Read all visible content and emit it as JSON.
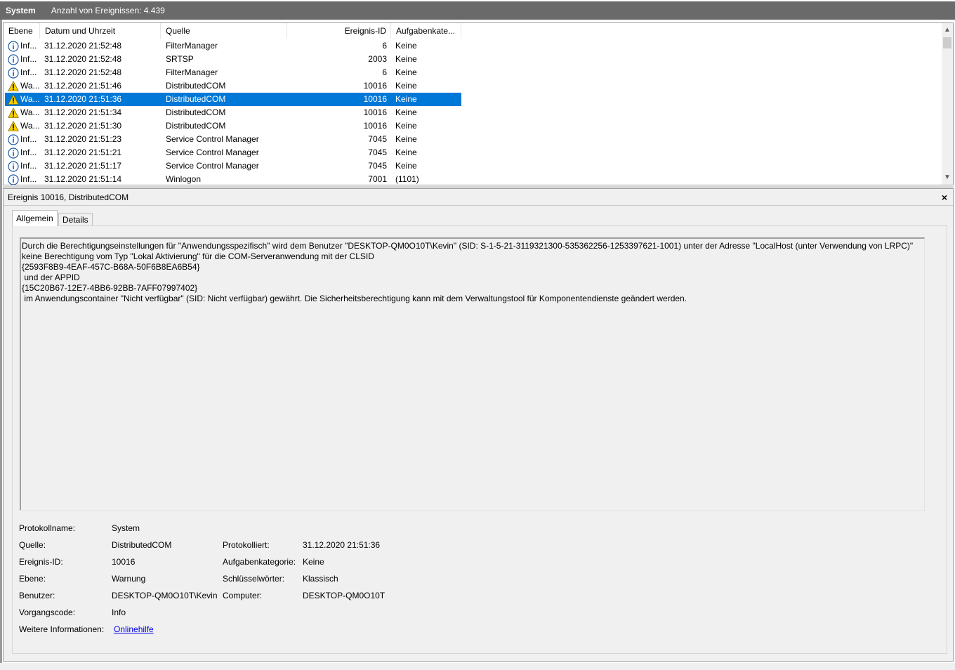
{
  "title": {
    "log": "System",
    "count_label": "Anzahl von Ereignissen: 4.439"
  },
  "columns": {
    "level": "Ebene",
    "date": "Datum und Uhrzeit",
    "source": "Quelle",
    "id": "Ereignis-ID",
    "task": "Aufgabenkate..."
  },
  "events": [
    {
      "type": "info",
      "level": "Inf...",
      "date": "31.12.2020 21:52:48",
      "source": "FilterManager",
      "id": "6",
      "task": "Keine"
    },
    {
      "type": "info",
      "level": "Inf...",
      "date": "31.12.2020 21:52:48",
      "source": "SRTSP",
      "id": "2003",
      "task": "Keine"
    },
    {
      "type": "info",
      "level": "Inf...",
      "date": "31.12.2020 21:52:48",
      "source": "FilterManager",
      "id": "6",
      "task": "Keine"
    },
    {
      "type": "warning",
      "level": "Wa...",
      "date": "31.12.2020 21:51:46",
      "source": "DistributedCOM",
      "id": "10016",
      "task": "Keine"
    },
    {
      "type": "warning",
      "level": "Wa...",
      "date": "31.12.2020 21:51:36",
      "source": "DistributedCOM",
      "id": "10016",
      "task": "Keine",
      "selected": true
    },
    {
      "type": "warning",
      "level": "Wa...",
      "date": "31.12.2020 21:51:34",
      "source": "DistributedCOM",
      "id": "10016",
      "task": "Keine"
    },
    {
      "type": "warning",
      "level": "Wa...",
      "date": "31.12.2020 21:51:30",
      "source": "DistributedCOM",
      "id": "10016",
      "task": "Keine"
    },
    {
      "type": "info",
      "level": "Inf...",
      "date": "31.12.2020 21:51:23",
      "source": "Service Control Manager",
      "id": "7045",
      "task": "Keine"
    },
    {
      "type": "info",
      "level": "Inf...",
      "date": "31.12.2020 21:51:21",
      "source": "Service Control Manager",
      "id": "7045",
      "task": "Keine"
    },
    {
      "type": "info",
      "level": "Inf...",
      "date": "31.12.2020 21:51:17",
      "source": "Service Control Manager",
      "id": "7045",
      "task": "Keine"
    },
    {
      "type": "info",
      "level": "Inf...",
      "date": "31.12.2020 21:51:14",
      "source": "Winlogon",
      "id": "7001",
      "task": "(1101)"
    }
  ],
  "detail": {
    "header": "Ereignis 10016, DistributedCOM",
    "close": "×",
    "tabs": {
      "general": "Allgemein",
      "details": "Details"
    },
    "message": "Durch die Berechtigungseinstellungen für \"Anwendungsspezifisch\" wird dem Benutzer \"DESKTOP-QM0O10T\\Kevin\" (SID: S-1-5-21-3119321300-535362256-1253397621-1001) unter der Adresse \"LocalHost (unter Verwendung von LRPC)\" keine Berechtigung vom Typ \"Lokal Aktivierung\" für die COM-Serveranwendung mit der CLSID \n{2593F8B9-4EAF-457C-B68A-50F6B8EA6B54}\n und der APPID \n{15C20B67-12E7-4BB6-92BB-7AFF07997402}\n im Anwendungscontainer \"Nicht verfügbar\" (SID: Nicht verfügbar) gewährt. Die Sicherheitsberechtigung kann mit dem Verwaltungstool für Komponentendienste geändert werden.",
    "fields": {
      "log_name_label": "Protokollname:",
      "log_name": "System",
      "source_label": "Quelle:",
      "source": "DistributedCOM",
      "logged_label": "Protokolliert:",
      "logged": "31.12.2020 21:51:36",
      "event_id_label": "Ereignis-ID:",
      "event_id": "10016",
      "task_label": "Aufgabenkategorie:",
      "task": "Keine",
      "level_label": "Ebene:",
      "level": "Warnung",
      "keywords_label": "Schlüsselwörter:",
      "keywords": "Klassisch",
      "user_label": "Benutzer:",
      "user": "DESKTOP-QM0O10T\\Kevin",
      "computer_label": "Computer:",
      "computer": "DESKTOP-QM0O10T",
      "opcode_label": "Vorgangscode:",
      "opcode": "Info",
      "more_info_label": "Weitere Informationen:",
      "more_info_link": "Onlinehilfe"
    }
  },
  "colors": {
    "selection": "#0078d7",
    "titlebar": "#6a6a6a",
    "warning": "#f7d000",
    "info_ring": "#1c5aa6"
  },
  "icons": {
    "info": "info-icon",
    "warning": "warning-icon"
  }
}
